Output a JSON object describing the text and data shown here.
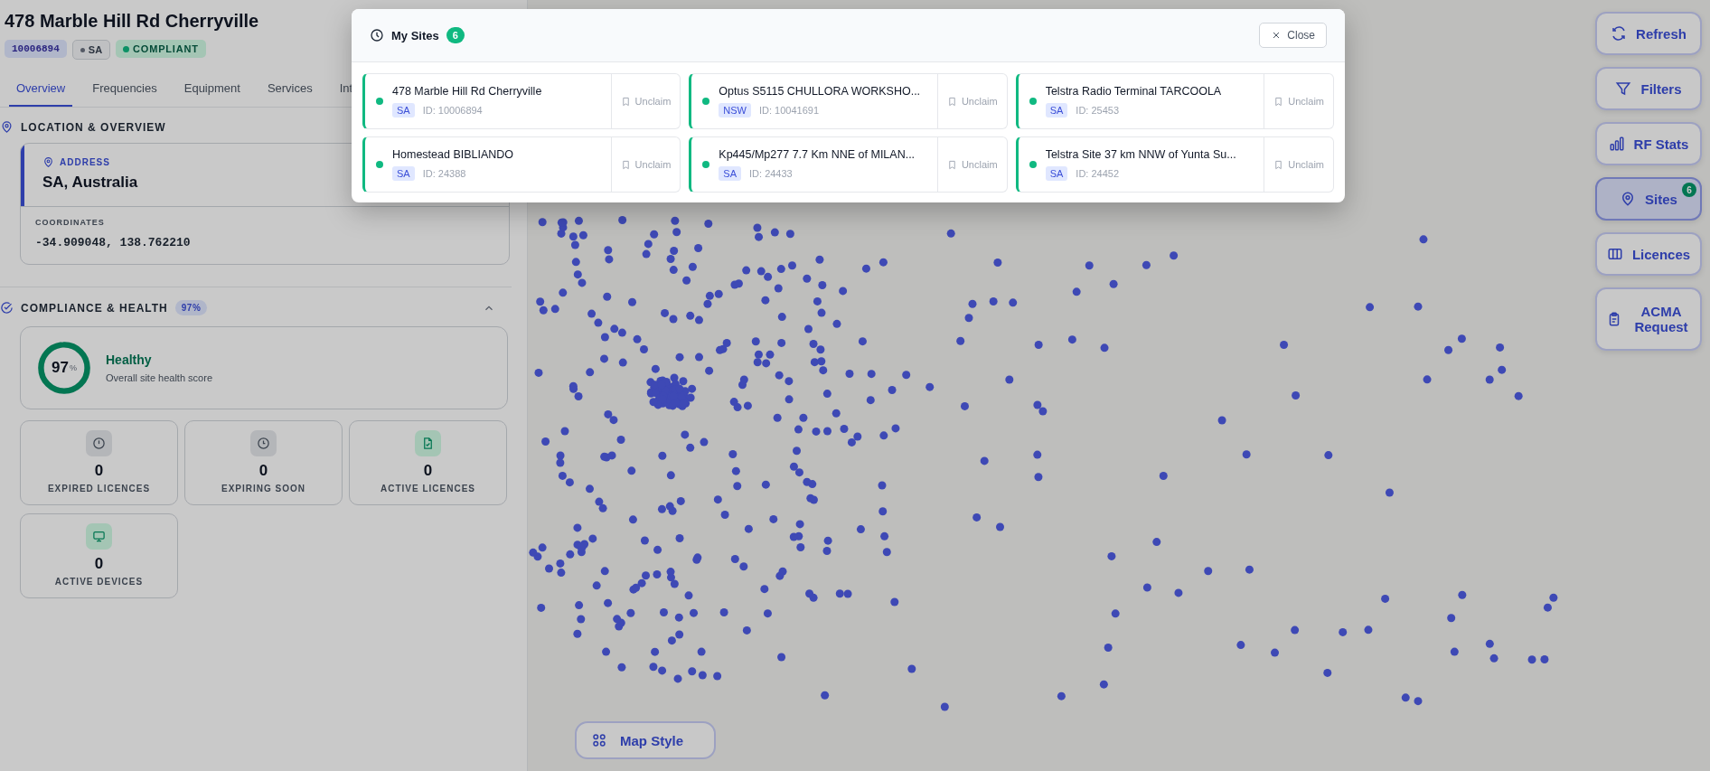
{
  "site": {
    "title": "478 Marble Hill Rd Cherryville",
    "id_badge": "10006894",
    "state_badge": "SA",
    "status_badge": "COMPLIANT"
  },
  "tabs": [
    {
      "label": "Overview",
      "selected": true
    },
    {
      "label": "Frequencies",
      "selected": false
    },
    {
      "label": "Equipment",
      "selected": false
    },
    {
      "label": "Services",
      "selected": false
    },
    {
      "label": "Int",
      "selected": false
    }
  ],
  "location": {
    "heading": "LOCATION & OVERVIEW",
    "address_label": "ADDRESS",
    "address": "SA, Australia",
    "coordinates_label": "COORDINATES",
    "coordinates": "-34.909048, 138.762210"
  },
  "compliance": {
    "heading": "COMPLIANCE & HEALTH",
    "badge": "97%",
    "expanded": true,
    "health": {
      "score": "97",
      "unit": "%",
      "level": 0.97,
      "status": "Healthy",
      "description": "Overall site health score"
    },
    "stats": [
      {
        "kind": "alert",
        "highlighted": false,
        "value": "0",
        "label": "EXPIRED LICENCES"
      },
      {
        "kind": "clock",
        "highlighted": false,
        "value": "0",
        "label": "EXPIRING SOON"
      },
      {
        "kind": "file",
        "highlighted": true,
        "value": "0",
        "label": "ACTIVE LICENCES"
      },
      {
        "kind": "monitor",
        "highlighted": true,
        "value": "0",
        "label": "ACTIVE DEVICES"
      }
    ]
  },
  "toolbar": [
    {
      "kind": "refresh",
      "label": "Refresh",
      "selected": false
    },
    {
      "kind": "filter",
      "label": "Filters",
      "selected": false
    },
    {
      "kind": "stats",
      "label": "RF Stats",
      "selected": false
    },
    {
      "kind": "pin",
      "label": "Sites",
      "selected": true,
      "badge": "6"
    },
    {
      "kind": "columns",
      "label": "Licences",
      "selected": false
    },
    {
      "kind": "clipboard",
      "label": "ACMA Request",
      "selected": false
    }
  ],
  "map_style_button": "Map Style",
  "modal": {
    "title": "My Sites",
    "count": "6",
    "close": "Close",
    "sites": [
      {
        "name": "478 Marble Hill Rd Cherryville",
        "state": "SA",
        "id": "ID: 10006894",
        "action": "Unclaim"
      },
      {
        "name": "Optus S5115 CHULLORA WORKSHO...",
        "state": "NSW",
        "id": "ID: 10041691",
        "action": "Unclaim"
      },
      {
        "name": "Telstra Radio Terminal TARCOOLA",
        "state": "SA",
        "id": "ID: 25453",
        "action": "Unclaim"
      },
      {
        "name": "Homestead BIBLIANDO",
        "state": "SA",
        "id": "ID: 24388",
        "action": "Unclaim"
      },
      {
        "name": "Kp445/Mp277 7.7 Km NNE of MILAN...",
        "state": "SA",
        "id": "ID: 24433",
        "action": "Unclaim"
      },
      {
        "name": "Telstra Site 37 km NNW of Yunta Su...",
        "state": "SA",
        "id": "ID: 24452",
        "action": "Unclaim"
      }
    ]
  }
}
